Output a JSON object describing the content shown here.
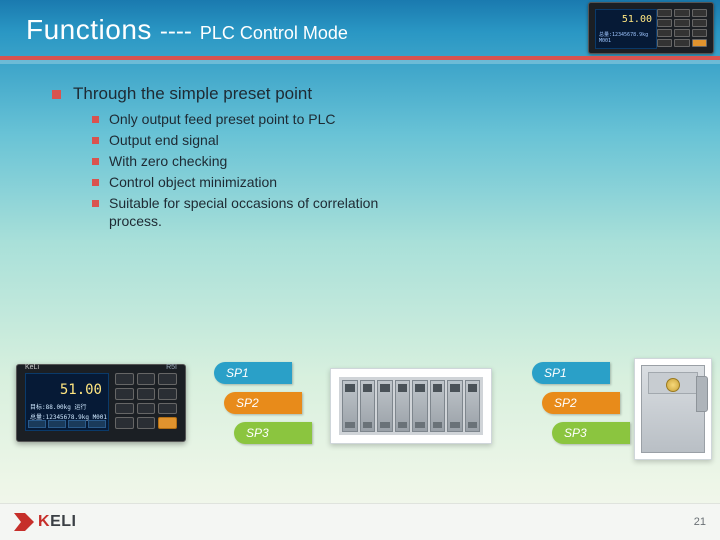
{
  "title": {
    "main": "Functions",
    "dash": "----",
    "sub": "PLC Control Mode"
  },
  "body": {
    "heading": "Through the simple preset point",
    "items": [
      "Only output feed preset point to PLC",
      "Output end signal",
      "With zero checking",
      "Control object minimization",
      "Suitable for special occasions of correlation process."
    ]
  },
  "device": {
    "brand": "KeLi",
    "model": "R5I",
    "display_value": "51.00",
    "display_unit": "kg",
    "line1": "目标:88.00kg  运行",
    "line2": "总量:12345678.9kg M001"
  },
  "sp": {
    "sp1": "SP1",
    "sp2": "SP2",
    "sp3": "SP3"
  },
  "footer": {
    "brand_html": "KeLi",
    "page": "21"
  }
}
